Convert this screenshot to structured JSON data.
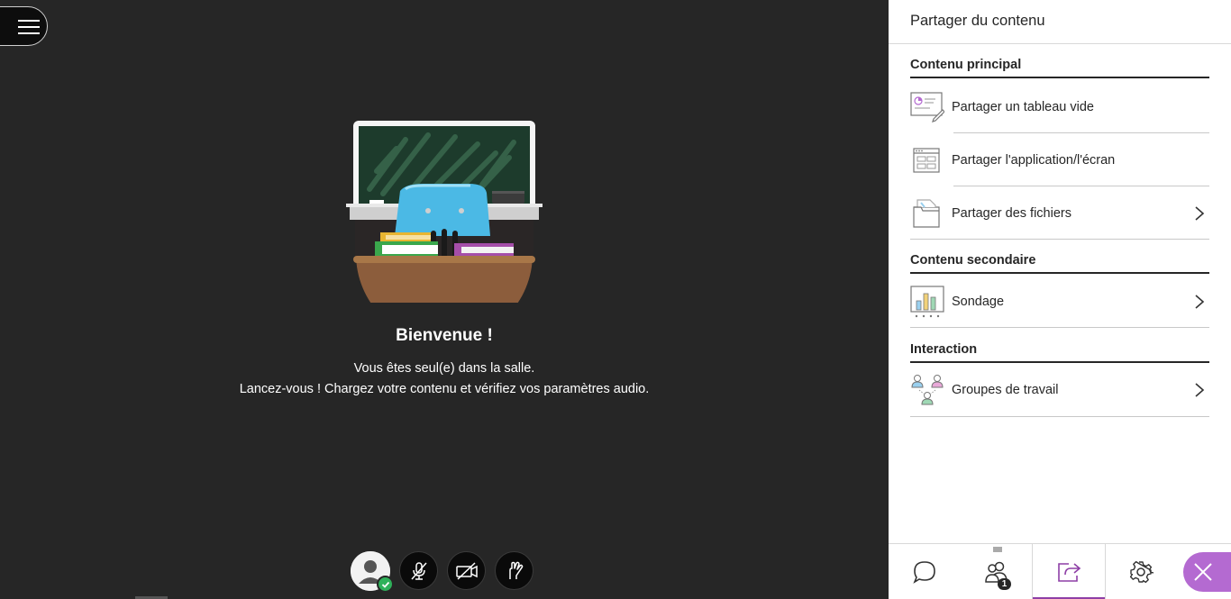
{
  "stage": {
    "welcome_title": "Bienvenue !",
    "welcome_line1": "Vous êtes seul(e) dans la salle.",
    "welcome_line2": "Lancez-vous ! Chargez votre contenu et vérifiez vos paramètres audio."
  },
  "controls": {
    "avatar_icon": "user-avatar-icon",
    "mic_icon": "microphone-off-icon",
    "camera_icon": "camera-off-icon",
    "hand_icon": "raise-hand-icon"
  },
  "panel": {
    "title": "Partager du contenu",
    "sections": {
      "primary": "Contenu principal",
      "secondary": "Contenu secondaire",
      "interaction": "Interaction"
    },
    "items": {
      "whiteboard": "Partager un tableau vide",
      "screen": "Partager l'application/l'écran",
      "files": "Partager des fichiers",
      "poll": "Sondage",
      "groups": "Groupes de travail"
    },
    "footer": {
      "participants_count": "1"
    }
  },
  "colors": {
    "accent": "#8e3fa6",
    "close_bg": "#b46ad1",
    "stage_bg": "#262626",
    "status_green": "#2fb15a"
  }
}
